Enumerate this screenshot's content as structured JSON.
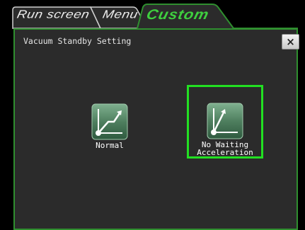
{
  "tabs": [
    {
      "label": "Run screen",
      "active": false
    },
    {
      "label": "Menu",
      "active": false
    },
    {
      "label": "Custom",
      "active": true
    }
  ],
  "panel": {
    "title": "Vacuum Standby Setting",
    "close_label": "×"
  },
  "options": [
    {
      "label": "Normal",
      "icon": "normal-curve-icon",
      "selected": false
    },
    {
      "label": "No Waiting\nAcceleration",
      "icon": "no-waiting-curve-icon",
      "selected": true
    }
  ],
  "colors": {
    "accent": "#3fcf3f",
    "selection": "#22e022",
    "panel_bg": "#2b2b2b"
  }
}
